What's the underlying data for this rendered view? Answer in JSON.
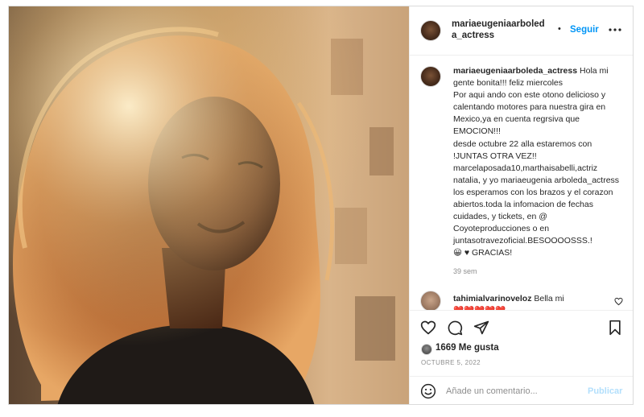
{
  "post": {
    "username": "mariaeugeniaarboleda_actress",
    "separator": "•",
    "follow_label": "Seguir",
    "caption_lines": [
      "Hola mi gente bonita!!! feliz miercoles",
      "Por aqui ando con este otono delicioso y calentando motores para nuestra gira en Mexico,ya en cuenta regrsiva que EMOCION!!!",
      "desde octubre 22 alla estaremos con !JUNTAS OTRA VEZ!!",
      "marcelaposada10,marthaisabelli,actriz natalia, y yo mariaeugenia arboleda_actress los esperamos con los brazos y el corazon abiertos.toda la infomacion de fechas cuidades, y tickets, en @ Coyoteproducciones o en juntasotravezoficial.BESOOOOSSS.!",
      "😀 ♥ GRACIAS!"
    ],
    "time_ago": "39 sem",
    "comment": {
      "username": "tahimialvarinoveloz",
      "text": "Bella mi",
      "text_cont": "❤️❤️❤️❤️❤️"
    },
    "likes": "1669 Me gusta",
    "date": "OCTUBRE 5, 2022",
    "comment_placeholder": "Añade un comentario...",
    "publish_label": "Publicar"
  },
  "icons": {
    "more": "more-options-icon",
    "like": "heart-icon",
    "comment": "comment-icon",
    "share": "share-icon",
    "save": "bookmark-icon",
    "emoji": "emoji-icon"
  },
  "colors": {
    "accent": "#0095f6",
    "publish_disabled": "#b2dffc",
    "muted": "#8e8e8e",
    "text": "#262626"
  }
}
